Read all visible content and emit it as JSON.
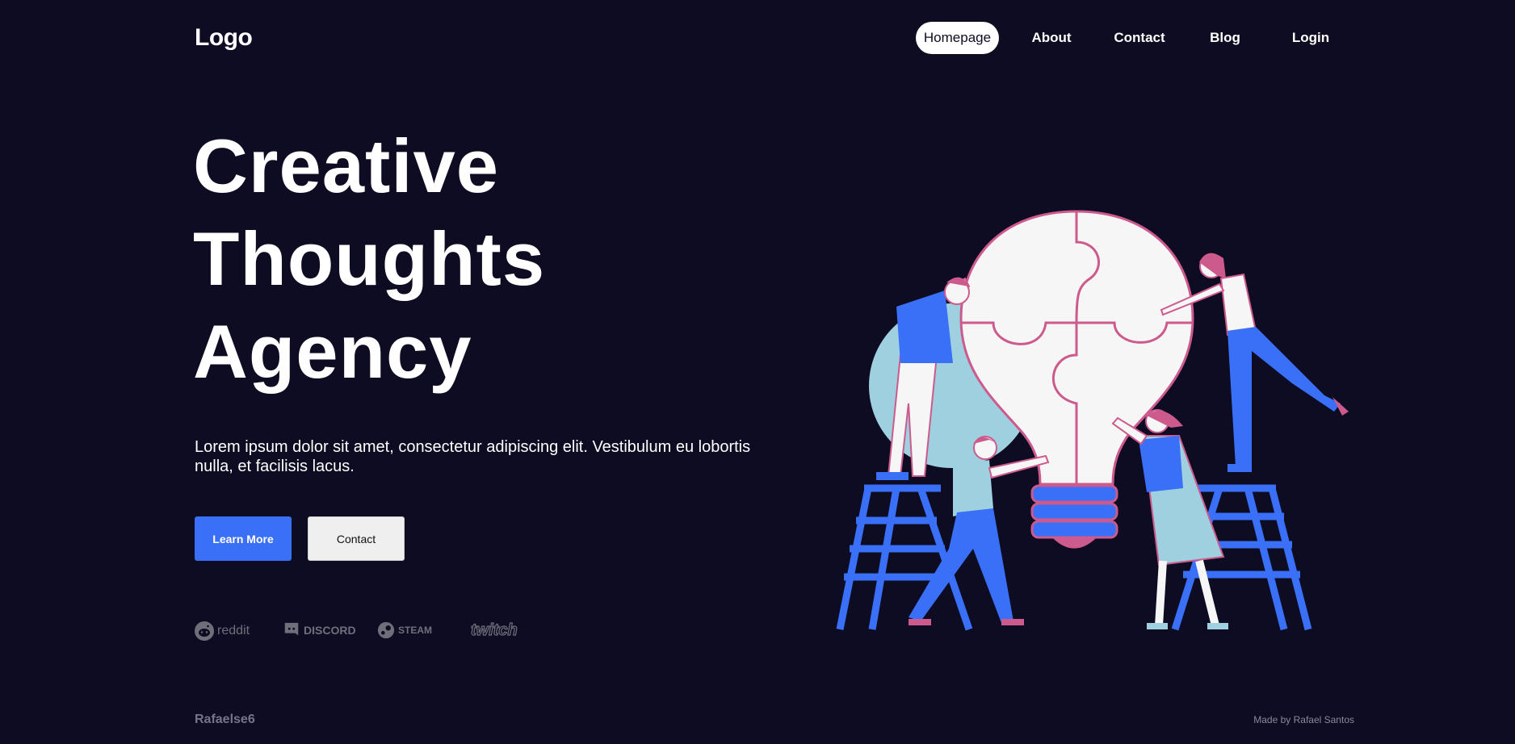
{
  "header": {
    "logo": "Logo",
    "nav": [
      "Homepage",
      "About",
      "Contact",
      "Blog",
      "Login"
    ],
    "active_nav": "Homepage"
  },
  "hero": {
    "title_lines": [
      "Creative",
      "Thoughts",
      "Agency"
    ],
    "description": "Lorem ipsum dolor sit amet, consectetur adipiscing elit. Vestibulum eu lobortis nulla, et facilisis lacus.",
    "primary_button": "Learn More",
    "secondary_button": "Contact"
  },
  "brands": [
    {
      "name": "reddit",
      "icon": "reddit-icon"
    },
    {
      "name": "DISCORD",
      "icon": "discord-icon"
    },
    {
      "name": "STEAM",
      "icon": "steam-icon"
    },
    {
      "name": "twitch",
      "icon": "twitch-icon"
    }
  ],
  "footer": {
    "left": "Rafaelse6",
    "right": "Made by Rafael Santos"
  },
  "colors": {
    "background": "#0e0c22",
    "accent": "#3a6ff8",
    "illustration_pink": "#cc5a8c",
    "illustration_light_blue": "#9ed0df"
  }
}
